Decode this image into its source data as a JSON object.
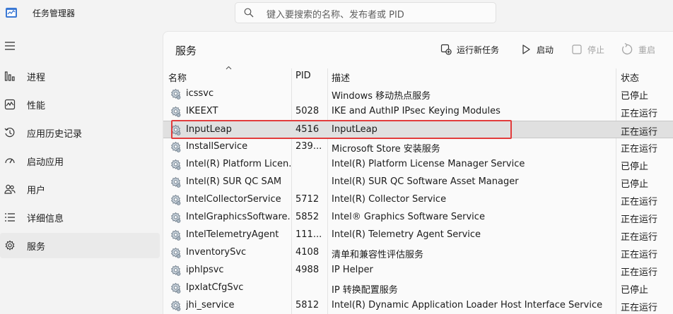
{
  "app": {
    "title": "任务管理器"
  },
  "search": {
    "placeholder": "键入要搜索的名称、发布者或 PID"
  },
  "nav": {
    "items": [
      {
        "label": "进程",
        "icon": "processes-icon"
      },
      {
        "label": "性能",
        "icon": "performance-icon"
      },
      {
        "label": "应用历史记录",
        "icon": "app-history-icon"
      },
      {
        "label": "启动应用",
        "icon": "startup-apps-icon"
      },
      {
        "label": "用户",
        "icon": "users-icon"
      },
      {
        "label": "详细信息",
        "icon": "details-icon"
      },
      {
        "label": "服务",
        "icon": "services-icon"
      }
    ],
    "active": "服务"
  },
  "page": {
    "title": "服务"
  },
  "toolbar": {
    "run_new_task": "运行新任务",
    "start": "启动",
    "stop": "停止",
    "restart": "重启"
  },
  "table": {
    "columns": {
      "name": "名称",
      "pid": "PID",
      "desc": "描述",
      "status": "状态"
    },
    "rows": [
      {
        "name": "icssvc",
        "pid": "",
        "desc": "Windows 移动热点服务",
        "status": "已停止"
      },
      {
        "name": "IKEEXT",
        "pid": "5028",
        "desc": "IKE and AuthIP IPsec Keying Modules",
        "status": "正在运行"
      },
      {
        "name": "InputLeap",
        "pid": "4516",
        "desc": "InputLeap",
        "status": "正在运行"
      },
      {
        "name": "InstallService",
        "pid": "239...",
        "desc": "Microsoft Store 安装服务",
        "status": "正在运行"
      },
      {
        "name": "Intel(R) Platform Licen...",
        "pid": "",
        "desc": "Intel(R) Platform License Manager Service",
        "status": "已停止"
      },
      {
        "name": "Intel(R) SUR QC SAM",
        "pid": "",
        "desc": "Intel(R) SUR QC Software Asset Manager",
        "status": "已停止"
      },
      {
        "name": "IntelCollectorService",
        "pid": "5712",
        "desc": "Intel(R) Collector Service",
        "status": "正在运行"
      },
      {
        "name": "IntelGraphicsSoftware...",
        "pid": "5852",
        "desc": "Intel® Graphics Software Service",
        "status": "正在运行"
      },
      {
        "name": "IntelTelemetryAgent",
        "pid": "111...",
        "desc": "Intel(R) Telemetry Agent Service",
        "status": "正在运行"
      },
      {
        "name": "InventorySvc",
        "pid": "4108",
        "desc": "清单和兼容性评估服务",
        "status": "正在运行"
      },
      {
        "name": "iphlpsvc",
        "pid": "4988",
        "desc": "IP Helper",
        "status": "正在运行"
      },
      {
        "name": "IpxlatCfgSvc",
        "pid": "",
        "desc": "IP 转换配置服务",
        "status": "已停止"
      },
      {
        "name": "jhi_service",
        "pid": "5812",
        "desc": "Intel(R) Dynamic Application Loader Host Interface Service",
        "status": "正在运行"
      }
    ],
    "selected_row": "InputLeap"
  },
  "colors": {
    "highlight_border": "#e23c3c",
    "selected_row": "#e0e0e0"
  }
}
